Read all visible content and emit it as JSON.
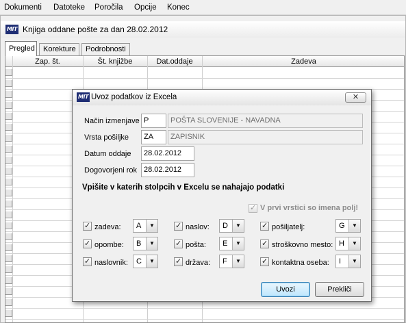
{
  "menubar": {
    "items": [
      "Dokumenti",
      "Datoteke",
      "Poročila",
      "Opcije",
      "Konec"
    ]
  },
  "window": {
    "logo": "MIT",
    "title": "Knjiga oddane pošte za dan 28.02.2012"
  },
  "tabs": [
    "Pregled",
    "Korekture",
    "Podrobnosti"
  ],
  "grid": {
    "columns": [
      "Zap. št.",
      "Št. knjižbe",
      "Dat.oddaje",
      "Zadeva"
    ]
  },
  "dialog": {
    "logo": "MIT",
    "title": "Uvoz podatkov iz Excela",
    "close_glyph": "✕",
    "fields": {
      "nacin": {
        "label": "Način izmenjave",
        "code": "P",
        "desc": "POŠTA SLOVENIJE - NAVADNA"
      },
      "vrsta": {
        "label": "Vrsta pošiljke",
        "code": "ZA",
        "desc": "ZAPISNIK"
      },
      "datum": {
        "label": "Datum oddaje",
        "value": "28.02.2012"
      },
      "dogovorjeni": {
        "label": "Dogovorjeni rok",
        "value": "28.02.2012"
      }
    },
    "heading": "Vpišite v katerih stolpcih v Excelu se nahajajo podatki",
    "first_row_label": "V prvi vrstici so imena polj!",
    "columns": [
      [
        {
          "label": "zadeva:",
          "value": "A"
        },
        {
          "label": "opombe:",
          "value": "B"
        },
        {
          "label": "naslovnik:",
          "value": "C"
        }
      ],
      [
        {
          "label": "naslov:",
          "value": "D"
        },
        {
          "label": "pošta:",
          "value": "E"
        },
        {
          "label": "država:",
          "value": "F"
        }
      ],
      [
        {
          "label": "pošiljatelj:",
          "value": "G"
        },
        {
          "label": "stroškovno mesto:",
          "value": "H"
        },
        {
          "label": "kontaktna oseba:",
          "value": "I"
        }
      ]
    ],
    "buttons": {
      "import": "Uvozi",
      "cancel": "Prekliči"
    }
  }
}
